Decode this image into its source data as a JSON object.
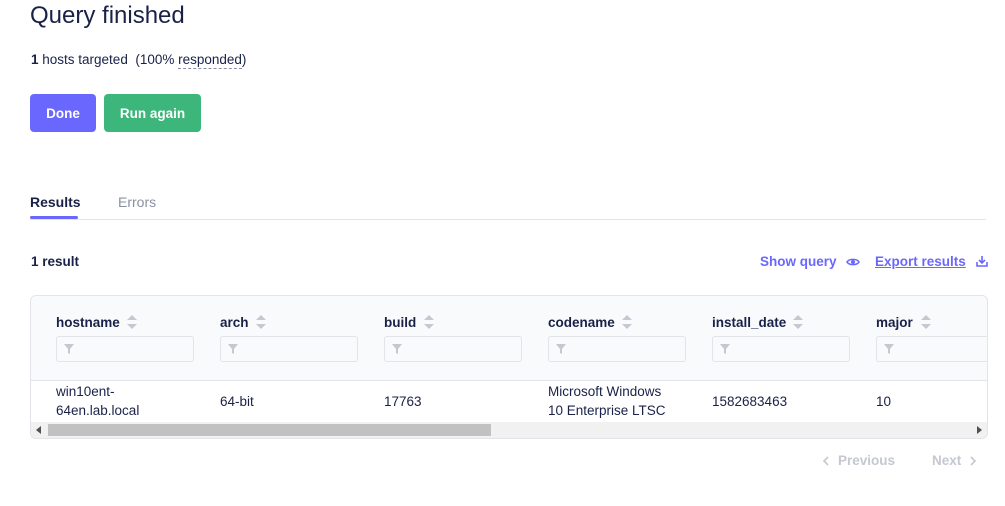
{
  "header": {
    "title": "Query finished",
    "hosts_count": "1",
    "hosts_text": " hosts targeted  (100% ",
    "responded_text": "responded",
    "hosts_suffix": ")"
  },
  "actions": {
    "done_label": "Done",
    "run_again_label": "Run again"
  },
  "tabs": [
    {
      "label": "Results",
      "active": true
    },
    {
      "label": "Errors",
      "active": false
    }
  ],
  "results": {
    "count_label": "1 result",
    "show_query_label": "Show query",
    "export_label": "Export results"
  },
  "table": {
    "columns": [
      "hostname",
      "arch",
      "build",
      "codename",
      "install_date",
      "major"
    ],
    "rows": [
      [
        "win10ent-64en.lab.local",
        "64-bit",
        "17763",
        "Microsoft Windows 10 Enterprise LTSC",
        "1582683463",
        "10"
      ]
    ]
  },
  "pagination": {
    "previous_label": "Previous",
    "next_label": "Next"
  },
  "colors": {
    "primary": "#6a67fe",
    "success": "#3db67b",
    "text": "#192147",
    "muted": "#8b8fa2"
  }
}
